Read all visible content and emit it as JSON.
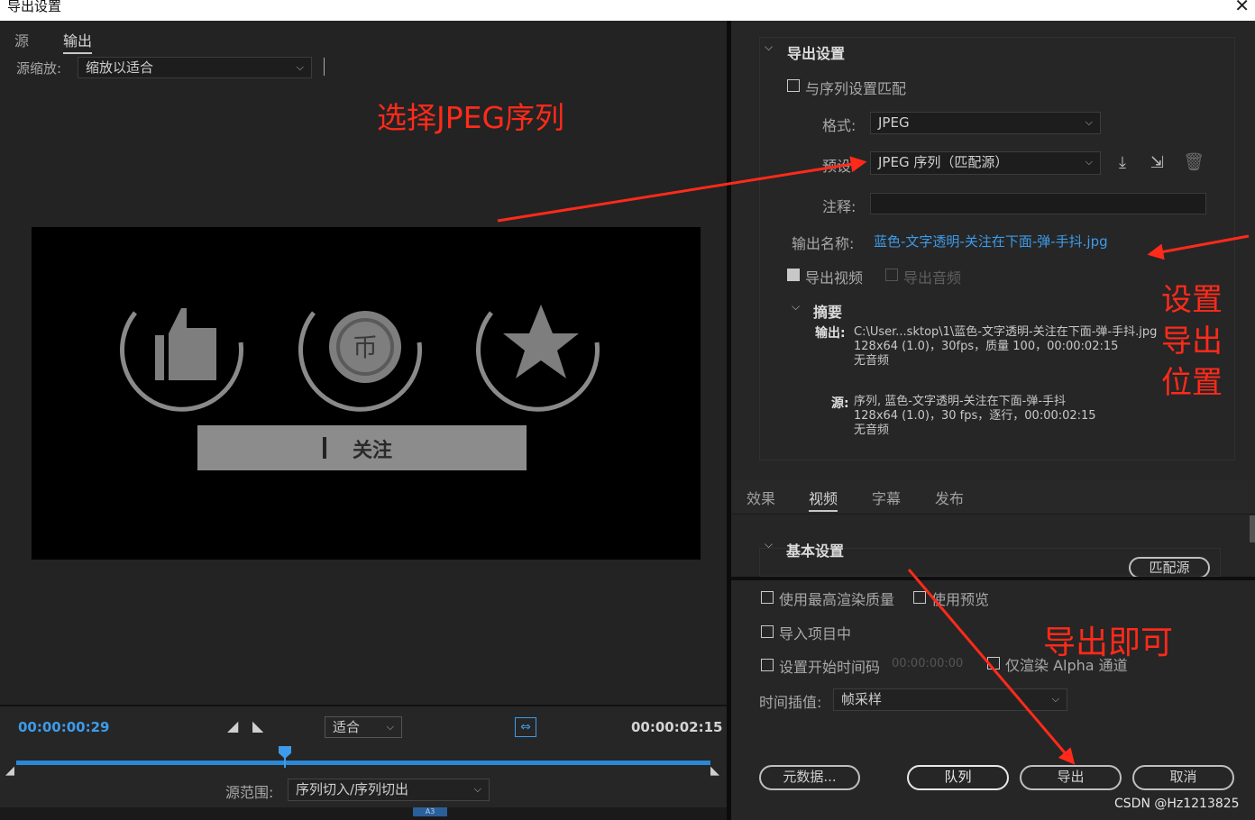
{
  "window": {
    "title": "导出设置",
    "close": "✕"
  },
  "left": {
    "tabs": [
      "源",
      "输出"
    ],
    "source_scale_label": "源缩放:",
    "source_scale_value": "缩放以适合",
    "timecode_current": "00:00:00:29",
    "timecode_total": "00:00:02:15",
    "fit_value": "适合",
    "source_range_label": "源范围:",
    "source_range_value": "序列切入/序列切出",
    "track_label": "A3"
  },
  "preview": {
    "button_text": "关注"
  },
  "annotations": {
    "select_jpeg": "选择JPEG序列",
    "set_location": "设置导出位置",
    "export_done": "导出即可"
  },
  "export_settings": {
    "header": "导出设置",
    "match_sequence": "与序列设置匹配",
    "format_label": "格式:",
    "format_value": "JPEG",
    "preset_label": "预设:",
    "preset_value": "JPEG 序列（匹配源）",
    "comment_label": "注释:",
    "comment_value": "",
    "output_name_label": "输出名称:",
    "output_name_value": "蓝色-文字透明-关注在下面-弹-手抖.jpg",
    "export_video": "导出视频",
    "export_audio": "导出音频",
    "export_video_checked": true,
    "export_audio_checked": false
  },
  "summary": {
    "header": "摘要",
    "output_label": "输出:",
    "output_line1": "C:\\User...sktop\\1\\蓝色-文字透明-关注在下面-弹-手抖.jpg",
    "output_line2": "128x64 (1.0)，30fps，质量 100，00:00:02:15",
    "output_line3": "无音频",
    "source_label": "源:",
    "source_line1": "序列, 蓝色-文字透明-关注在下面-弹-手抖",
    "source_line2": "128x64 (1.0)，30 fps，逐行，00:00:02:15",
    "source_line3": "无音频"
  },
  "right_tabs": [
    "效果",
    "视频",
    "字幕",
    "发布"
  ],
  "active_right_tab": "视频",
  "basic": {
    "header": "基本设置",
    "match_source": "匹配源"
  },
  "options": {
    "max_render": "使用最高渲染质量",
    "use_preview": "使用预览",
    "import_project": "导入项目中",
    "set_start_tc": "设置开始时间码",
    "start_tc_value": "00:00:00:00",
    "alpha_only": "仅渲染 Alpha 通道",
    "interp_label": "时间插值:",
    "interp_value": "帧采样"
  },
  "buttons": {
    "metadata": "元数据...",
    "queue": "队列",
    "export": "导出",
    "cancel": "取消"
  },
  "watermark": "CSDN @Hz1213825",
  "colors": {
    "accent_blue": "#3d9bea",
    "annotation_red": "#ff2a1a"
  }
}
